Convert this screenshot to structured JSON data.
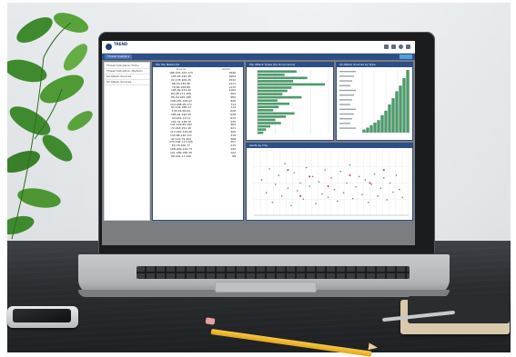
{
  "app": {
    "nav_tab": "Threat Analytics",
    "nav_button": "",
    "logo_text": "TREND",
    "logo_sub": ""
  },
  "filters_panel": {
    "title": "",
    "items": [
      "Threat Indicators: Firmy",
      "Threat Indicators: Medium",
      "All Attack Sources",
      "All Attack Sources"
    ]
  },
  "table_panel": {
    "title": "Top Ten Networks",
    "col_ip": "Source",
    "col_count": "Alerts",
    "rows": [
      {
        "ip": "186.225.102.173",
        "count": "1846"
      },
      {
        "ip": "195.93.192.48",
        "count": "1664"
      },
      {
        "ip": "22.178.209.25",
        "count": "1532"
      },
      {
        "ip": "86.29.145.96",
        "count": "1211"
      },
      {
        "ip": "79.84.158.89",
        "count": "1172"
      },
      {
        "ip": "165.29.223.42",
        "count": "1164"
      },
      {
        "ip": "84.28.171.166",
        "count": "962"
      },
      {
        "ip": "86.29.165.186",
        "count": "982"
      },
      {
        "ip": "198.235.108.42",
        "count": "826"
      },
      {
        "ip": "104.208.28.171",
        "count": "714"
      },
      {
        "ip": "82.134.188.13",
        "count": "714"
      },
      {
        "ip": "143.52.58.64",
        "count": "628"
      },
      {
        "ip": "185.64.192.33",
        "count": "628"
      },
      {
        "ip": "94.201.117.9",
        "count": "612"
      },
      {
        "ip": "191.31.238.72",
        "count": "535"
      },
      {
        "ip": "141.126.85.192",
        "count": "469"
      },
      {
        "ip": "72.218.151.18",
        "count": "421"
      },
      {
        "ip": "113.225.149.26",
        "count": "406"
      },
      {
        "ip": "135.86.140.111",
        "count": "318"
      },
      {
        "ip": "42.119.79.204",
        "count": "268"
      },
      {
        "ip": "173.192.117.205",
        "count": "251"
      },
      {
        "ip": "65.76.106.77",
        "count": "215"
      },
      {
        "ip": "108.200.116.73",
        "count": "142"
      },
      {
        "ip": "101.189.186.45",
        "count": "122"
      },
      {
        "ip": "66.181.11.120",
        "count": "98"
      }
    ]
  },
  "chart1": {
    "title": "Top Attack Types (by Occurrence)"
  },
  "chart2": {
    "title": "All Attack Sources by Type"
  },
  "chart3": {
    "title": "Alerts by Day"
  },
  "chart_data": [
    {
      "type": "bar",
      "orientation": "horizontal",
      "categories": [
        "",
        "",
        "",
        "",
        "",
        "",
        "",
        "",
        "",
        "",
        "",
        "",
        "",
        "",
        "",
        "",
        "",
        "",
        "",
        ""
      ],
      "values": [
        0.55,
        0.38,
        0.7,
        0.5,
        0.95,
        0.48,
        0.42,
        0.35,
        0.62,
        0.28,
        0.45,
        0.3,
        0.22,
        0.52,
        0.4,
        0.25,
        0.33,
        0.18,
        0.12,
        0.08
      ],
      "title": "Top Attack Types (by Occurrence)",
      "xlabel": "",
      "ylabel": "",
      "grid": true
    },
    {
      "type": "bar",
      "orientation": "vertical",
      "categories": [
        "",
        "",
        "",
        "",
        "",
        "",
        "",
        "",
        "",
        "",
        "",
        "",
        ""
      ],
      "values": [
        0.05,
        0.08,
        0.12,
        0.16,
        0.2,
        0.28,
        0.35,
        0.45,
        0.55,
        0.66,
        0.75,
        0.87,
        1.0
      ],
      "title": "All Attack Sources by Type",
      "grid": true
    },
    {
      "type": "scatter",
      "title": "Alerts by Day",
      "points": [
        [
          0.05,
          0.55
        ],
        [
          0.08,
          0.35
        ],
        [
          0.1,
          0.72
        ],
        [
          0.12,
          0.2
        ],
        [
          0.14,
          0.48
        ],
        [
          0.16,
          0.62
        ],
        [
          0.18,
          0.3
        ],
        [
          0.2,
          0.8
        ],
        [
          0.22,
          0.42
        ],
        [
          0.24,
          0.15
        ],
        [
          0.26,
          0.66
        ],
        [
          0.28,
          0.38
        ],
        [
          0.3,
          0.5
        ],
        [
          0.32,
          0.25
        ],
        [
          0.34,
          0.74
        ],
        [
          0.36,
          0.45
        ],
        [
          0.38,
          0.6
        ],
        [
          0.4,
          0.18
        ],
        [
          0.42,
          0.52
        ],
        [
          0.44,
          0.33
        ],
        [
          0.46,
          0.7
        ],
        [
          0.48,
          0.28
        ],
        [
          0.5,
          0.58
        ],
        [
          0.52,
          0.4
        ],
        [
          0.54,
          0.22
        ],
        [
          0.56,
          0.68
        ],
        [
          0.58,
          0.35
        ],
        [
          0.6,
          0.5
        ],
        [
          0.62,
          0.78
        ],
        [
          0.64,
          0.26
        ],
        [
          0.66,
          0.44
        ],
        [
          0.68,
          0.6
        ],
        [
          0.7,
          0.32
        ],
        [
          0.72,
          0.55
        ],
        [
          0.74,
          0.2
        ],
        [
          0.76,
          0.48
        ],
        [
          0.78,
          0.64
        ],
        [
          0.8,
          0.3
        ],
        [
          0.82,
          0.42
        ],
        [
          0.84,
          0.58
        ],
        [
          0.86,
          0.24
        ],
        [
          0.88,
          0.5
        ],
        [
          0.9,
          0.36
        ],
        [
          0.92,
          0.62
        ],
        [
          0.94,
          0.4
        ],
        [
          0.96,
          0.28
        ]
      ],
      "highlight_points": [
        [
          0.22,
          0.7
        ],
        [
          0.36,
          0.6
        ],
        [
          0.48,
          0.45
        ],
        [
          0.62,
          0.62
        ],
        [
          0.75,
          0.5
        ],
        [
          0.3,
          0.3
        ],
        [
          0.84,
          0.7
        ]
      ],
      "grid": true
    }
  ],
  "colors": {
    "bar_green": "#4f9a6d",
    "panel_navy": "#2d4f86",
    "highlight_red": "#c0392b"
  }
}
